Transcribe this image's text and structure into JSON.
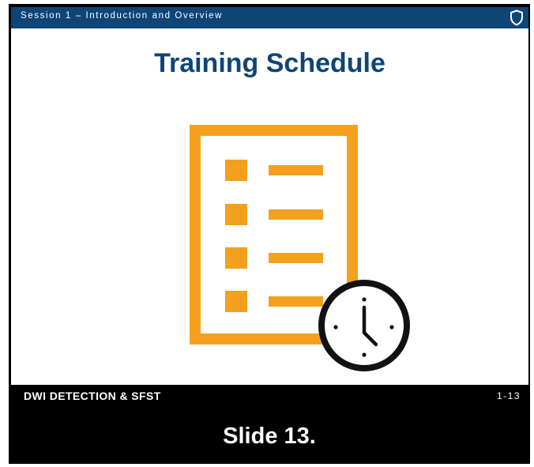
{
  "colors": {
    "header_bar": "#0e4577",
    "title": "#0e4577",
    "accent_orange": "#f4a01f",
    "frame_background": "#000000",
    "text_on_dark": "#ffffff"
  },
  "header": {
    "session_title": "Session 1 – Introduction and Overview",
    "emblem_icon": "shield-outline-icon"
  },
  "slide": {
    "title": "Training Schedule",
    "illustration_icons": [
      "checklist-document-icon",
      "clock-icon"
    ]
  },
  "footer": {
    "brand": "DWI DETECTION & SFST",
    "page_number": "1-13"
  },
  "caption": "Slide 13."
}
